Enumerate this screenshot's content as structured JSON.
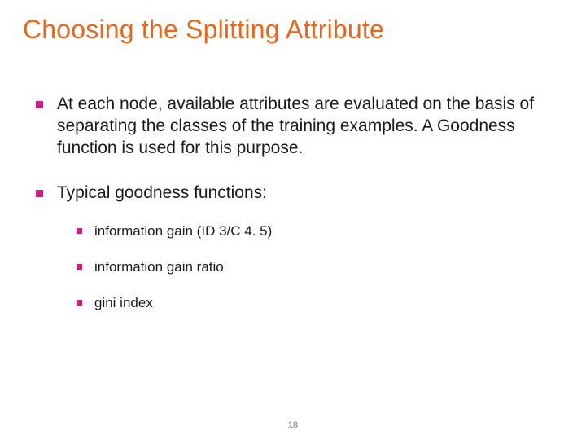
{
  "title": "Choosing the Splitting Attribute",
  "bullets": [
    {
      "text": "At each node, available attributes are evaluated on the basis of separating the classes of the training examples. A Goodness function is used for this purpose."
    },
    {
      "text": "Typical goodness functions:",
      "sub": [
        "information gain (ID 3/C 4. 5)",
        "information gain ratio",
        "gini index"
      ]
    }
  ],
  "page_number": "18"
}
